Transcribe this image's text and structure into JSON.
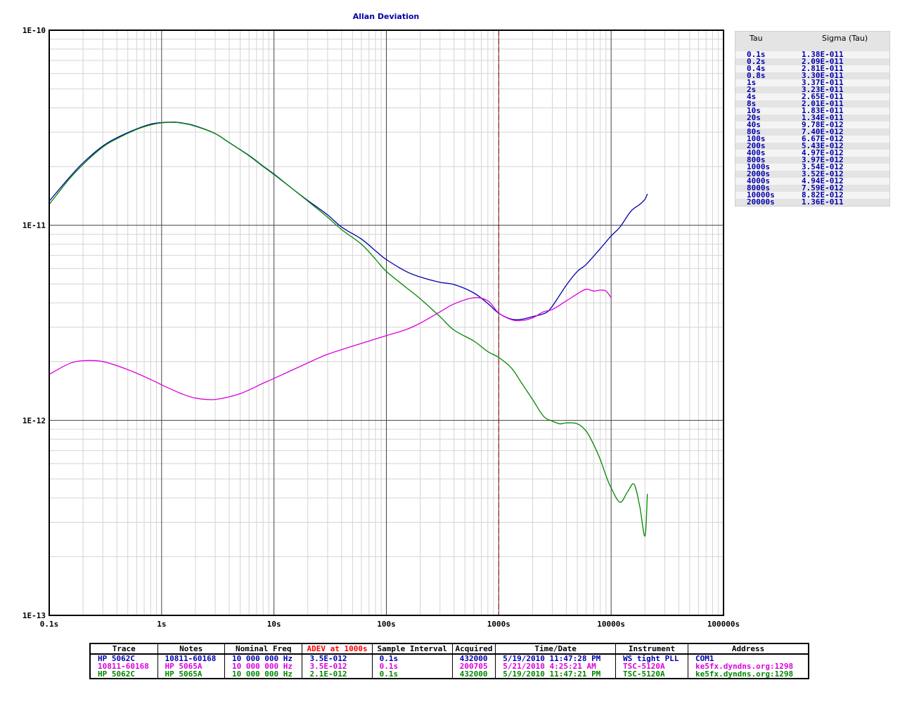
{
  "chart_data": {
    "type": "line",
    "title": "Allan Deviation",
    "x_scale": "log",
    "y_scale": "log",
    "xlim": [
      0.1,
      100000
    ],
    "ylim": [
      1e-13,
      1e-10
    ],
    "x_tick_labels": [
      "0.1s",
      "1s",
      "10s",
      "100s",
      "1000s",
      "10000s",
      "100000s"
    ],
    "y_tick_labels": [
      "1E-10",
      "1E-11",
      "1E-12",
      "1E-13"
    ],
    "grid": true,
    "marker_line": {
      "x": 1000,
      "color": "#aa0000"
    },
    "series": [
      {
        "name": "HP 5062C",
        "color": "#0000aa",
        "points": [
          [
            0.1,
            1.33e-11
          ],
          [
            0.15,
            1.75e-11
          ],
          [
            0.2,
            2.09e-11
          ],
          [
            0.3,
            2.55e-11
          ],
          [
            0.4,
            2.81e-11
          ],
          [
            0.6,
            3.12e-11
          ],
          [
            0.8,
            3.3e-11
          ],
          [
            1,
            3.36e-11
          ],
          [
            1.3,
            3.38e-11
          ],
          [
            1.6,
            3.33e-11
          ],
          [
            2,
            3.23e-11
          ],
          [
            3,
            2.95e-11
          ],
          [
            4,
            2.65e-11
          ],
          [
            6,
            2.28e-11
          ],
          [
            8,
            2.01e-11
          ],
          [
            10,
            1.83e-11
          ],
          [
            15,
            1.52e-11
          ],
          [
            20,
            1.34e-11
          ],
          [
            30,
            1.13e-11
          ],
          [
            40,
            9.78e-12
          ],
          [
            60,
            8.5e-12
          ],
          [
            80,
            7.4e-12
          ],
          [
            100,
            6.67e-12
          ],
          [
            150,
            5.8e-12
          ],
          [
            200,
            5.43e-12
          ],
          [
            300,
            5.1e-12
          ],
          [
            400,
            4.97e-12
          ],
          [
            600,
            4.5e-12
          ],
          [
            800,
            3.97e-12
          ],
          [
            1000,
            3.54e-12
          ],
          [
            1300,
            3.3e-12
          ],
          [
            1600,
            3.3e-12
          ],
          [
            2000,
            3.4e-12
          ],
          [
            2600,
            3.55e-12
          ],
          [
            3000,
            3.85e-12
          ],
          [
            4000,
            4.94e-12
          ],
          [
            5000,
            5.8e-12
          ],
          [
            6000,
            6.3e-12
          ],
          [
            8000,
            7.59e-12
          ],
          [
            10000,
            8.82e-12
          ],
          [
            12000,
            9.8e-12
          ],
          [
            15000,
            1.18e-11
          ],
          [
            18000,
            1.28e-11
          ],
          [
            20000,
            1.36e-11
          ],
          [
            21000,
            1.45e-11
          ]
        ]
      },
      {
        "name": "10811-60168",
        "color": "#dd00dd",
        "points": [
          [
            0.1,
            1.72e-12
          ],
          [
            0.15,
            1.95e-12
          ],
          [
            0.2,
            2.02e-12
          ],
          [
            0.3,
            2e-12
          ],
          [
            0.5,
            1.82e-12
          ],
          [
            0.8,
            1.62e-12
          ],
          [
            1,
            1.52e-12
          ],
          [
            1.5,
            1.37e-12
          ],
          [
            2,
            1.3e-12
          ],
          [
            3,
            1.28e-12
          ],
          [
            5,
            1.37e-12
          ],
          [
            8,
            1.55e-12
          ],
          [
            10,
            1.64e-12
          ],
          [
            20,
            1.97e-12
          ],
          [
            30,
            2.18e-12
          ],
          [
            50,
            2.4e-12
          ],
          [
            70,
            2.55e-12
          ],
          [
            100,
            2.72e-12
          ],
          [
            150,
            2.92e-12
          ],
          [
            200,
            3.15e-12
          ],
          [
            300,
            3.6e-12
          ],
          [
            400,
            3.95e-12
          ],
          [
            600,
            4.25e-12
          ],
          [
            800,
            4.1e-12
          ],
          [
            1000,
            3.55e-12
          ],
          [
            1300,
            3.28e-12
          ],
          [
            1600,
            3.25e-12
          ],
          [
            2000,
            3.35e-12
          ],
          [
            2500,
            3.6e-12
          ],
          [
            3000,
            3.7e-12
          ],
          [
            4000,
            4.1e-12
          ],
          [
            5000,
            4.45e-12
          ],
          [
            6000,
            4.7e-12
          ],
          [
            7000,
            4.6e-12
          ],
          [
            8000,
            4.65e-12
          ],
          [
            9000,
            4.6e-12
          ],
          [
            10000,
            4.25e-12
          ]
        ]
      },
      {
        "name": "HP 5062C",
        "color": "#008800",
        "points": [
          [
            0.1,
            1.28e-11
          ],
          [
            0.15,
            1.72e-11
          ],
          [
            0.2,
            2.05e-11
          ],
          [
            0.3,
            2.52e-11
          ],
          [
            0.4,
            2.78e-11
          ],
          [
            0.6,
            3.1e-11
          ],
          [
            0.8,
            3.27e-11
          ],
          [
            1,
            3.35e-11
          ],
          [
            1.3,
            3.37e-11
          ],
          [
            1.6,
            3.32e-11
          ],
          [
            2,
            3.22e-11
          ],
          [
            3,
            2.95e-11
          ],
          [
            4,
            2.65e-11
          ],
          [
            6,
            2.27e-11
          ],
          [
            8,
            2e-11
          ],
          [
            10,
            1.82e-11
          ],
          [
            15,
            1.52e-11
          ],
          [
            20,
            1.33e-11
          ],
          [
            30,
            1.1e-11
          ],
          [
            40,
            9.5e-12
          ],
          [
            60,
            8e-12
          ],
          [
            80,
            6.7e-12
          ],
          [
            100,
            5.8e-12
          ],
          [
            150,
            4.8e-12
          ],
          [
            200,
            4.2e-12
          ],
          [
            300,
            3.4e-12
          ],
          [
            400,
            2.9e-12
          ],
          [
            600,
            2.55e-12
          ],
          [
            800,
            2.25e-12
          ],
          [
            1000,
            2.1e-12
          ],
          [
            1300,
            1.85e-12
          ],
          [
            1600,
            1.55e-12
          ],
          [
            2000,
            1.28e-12
          ],
          [
            2500,
            1.05e-12
          ],
          [
            3000,
            9.9e-13
          ],
          [
            3500,
            9.6e-13
          ],
          [
            4000,
            9.7e-13
          ],
          [
            5000,
            9.6e-13
          ],
          [
            6000,
            8.8e-13
          ],
          [
            7000,
            7.5e-13
          ],
          [
            8000,
            6.3e-13
          ],
          [
            9000,
            5.2e-13
          ],
          [
            10000,
            4.5e-13
          ],
          [
            12000,
            3.8e-13
          ],
          [
            14000,
            4.3e-13
          ],
          [
            16000,
            4.7e-13
          ],
          [
            18000,
            3.6e-13
          ],
          [
            20000,
            2.55e-13
          ],
          [
            21000,
            4.2e-13
          ]
        ]
      }
    ]
  },
  "sigma_table": {
    "header_tau": "Tau",
    "header_sigma": "Sigma (Tau)",
    "rows": [
      [
        "0.1s",
        "1.38E-011"
      ],
      [
        "0.2s",
        "2.09E-011"
      ],
      [
        "0.4s",
        "2.81E-011"
      ],
      [
        "0.8s",
        "3.30E-011"
      ],
      [
        "1s",
        "3.37E-011"
      ],
      [
        "2s",
        "3.23E-011"
      ],
      [
        "4s",
        "2.65E-011"
      ],
      [
        "8s",
        "2.01E-011"
      ],
      [
        "10s",
        "1.83E-011"
      ],
      [
        "20s",
        "1.34E-011"
      ],
      [
        "40s",
        "9.78E-012"
      ],
      [
        "80s",
        "7.40E-012"
      ],
      [
        "100s",
        "6.67E-012"
      ],
      [
        "200s",
        "5.43E-012"
      ],
      [
        "400s",
        "4.97E-012"
      ],
      [
        "800s",
        "3.97E-012"
      ],
      [
        "1000s",
        "3.54E-012"
      ],
      [
        "2000s",
        "3.52E-012"
      ],
      [
        "4000s",
        "4.94E-012"
      ],
      [
        "8000s",
        "7.59E-012"
      ],
      [
        "10000s",
        "8.82E-012"
      ],
      [
        "20000s",
        "1.36E-011"
      ]
    ]
  },
  "trace_table": {
    "headers": [
      "Trace",
      "Notes",
      "Nominal Freq",
      "ADEV at 1000s",
      "Sample Interval",
      "Acquired",
      "Time/Date",
      "Instrument",
      "Address"
    ],
    "rows": [
      {
        "color": "blue",
        "cells": [
          "HP 5062C",
          "10811-60168",
          "10 000 000 Hz",
          "3.5E-012",
          "0.1s",
          "432000",
          "5/19/2010 11:47:28 PM",
          "WS tight PLL",
          "COM1"
        ]
      },
      {
        "color": "mag",
        "cells": [
          "10811-60168",
          "HP 5065A",
          "10 000 000 Hz",
          "3.5E-012",
          "0.1s",
          "200705",
          "5/21/2010 4:25:21 AM",
          "TSC-5120A",
          "ke5fx.dyndns.org:1298"
        ]
      },
      {
        "color": "green",
        "cells": [
          "HP 5062C",
          "HP 5065A",
          "10 000 000 Hz",
          "2.1E-012",
          "0.1s",
          "432000",
          "5/19/2010 11:47:21 PM",
          "TSC-5120A",
          "ke5fx.dyndns.org:1298"
        ]
      }
    ]
  }
}
